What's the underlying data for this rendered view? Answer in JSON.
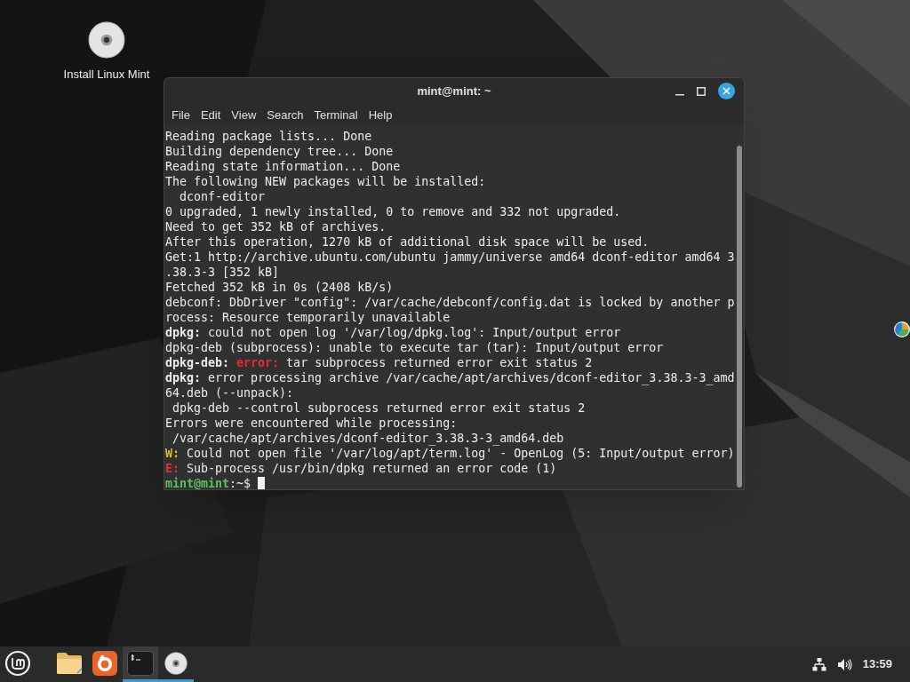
{
  "desktop_icons": [
    {
      "label": "Install Linux Mint"
    }
  ],
  "window": {
    "title": "mint@mint: ~",
    "menu": [
      "File",
      "Edit",
      "View",
      "Search",
      "Terminal",
      "Help"
    ]
  },
  "terminal": {
    "lines": [
      [
        {
          "kind": "plain",
          "text": "Reading package lists... Done"
        }
      ],
      [
        {
          "kind": "plain",
          "text": "Building dependency tree... Done"
        }
      ],
      [
        {
          "kind": "plain",
          "text": "Reading state information... Done"
        }
      ],
      [
        {
          "kind": "plain",
          "text": "The following NEW packages will be installed:"
        }
      ],
      [
        {
          "kind": "plain",
          "text": "  dconf-editor"
        }
      ],
      [
        {
          "kind": "plain",
          "text": "0 upgraded, 1 newly installed, 0 to remove and 332 not upgraded."
        }
      ],
      [
        {
          "kind": "plain",
          "text": "Need to get 352 kB of archives."
        }
      ],
      [
        {
          "kind": "plain",
          "text": "After this operation, 1270 kB of additional disk space will be used."
        }
      ],
      [
        {
          "kind": "plain",
          "text": "Get:1 http://archive.ubuntu.com/ubuntu jammy/universe amd64 dconf-editor amd64 3"
        }
      ],
      [
        {
          "kind": "plain",
          "text": ".38.3-3 [352 kB]"
        }
      ],
      [
        {
          "kind": "plain",
          "text": "Fetched 352 kB in 0s (2408 kB/s)"
        }
      ],
      [
        {
          "kind": "plain",
          "text": "debconf: DbDriver \"config\": /var/cache/debconf/config.dat is locked by another p"
        }
      ],
      [
        {
          "kind": "plain",
          "text": "rocess: Resource temporarily unavailable"
        }
      ],
      [
        {
          "kind": "bold",
          "text": "dpkg:"
        },
        {
          "kind": "plain",
          "text": " could not open log '/var/log/dpkg.log': Input/output error"
        }
      ],
      [
        {
          "kind": "plain",
          "text": "dpkg-deb (subprocess): unable to execute tar (tar): Input/output error"
        }
      ],
      [
        {
          "kind": "bold",
          "text": "dpkg-deb: "
        },
        {
          "kind": "error",
          "text": "error:"
        },
        {
          "kind": "plain",
          "text": " tar subprocess returned error exit status 2"
        }
      ],
      [
        {
          "kind": "bold",
          "text": "dpkg:"
        },
        {
          "kind": "plain",
          "text": " error processing archive /var/cache/apt/archives/dconf-editor_3.38.3-3_amd"
        }
      ],
      [
        {
          "kind": "plain",
          "text": "64.deb (--unpack):"
        }
      ],
      [
        {
          "kind": "plain",
          "text": " dpkg-deb --control subprocess returned error exit status 2"
        }
      ],
      [
        {
          "kind": "plain",
          "text": "Errors were encountered while processing:"
        }
      ],
      [
        {
          "kind": "plain",
          "text": " /var/cache/apt/archives/dconf-editor_3.38.3-3_amd64.deb"
        }
      ],
      [
        {
          "kind": "warning",
          "text": "W:"
        },
        {
          "kind": "plain",
          "text": " Could not open file '/var/log/apt/term.log' - OpenLog (5: Input/output error)"
        }
      ],
      [
        {
          "kind": "error",
          "text": "E:"
        },
        {
          "kind": "plain",
          "text": " Sub-process /usr/bin/dpkg returned an error code (1)"
        }
      ],
      [
        {
          "kind": "prompt",
          "text": "mint@mint"
        },
        {
          "kind": "plain",
          "text": ":~$ "
        }
      ]
    ]
  },
  "taskbar": {
    "items": [
      {
        "kind": "menu",
        "running": false,
        "focused": false
      },
      {
        "kind": "files",
        "running": false,
        "focused": false
      },
      {
        "kind": "firefox",
        "running": false,
        "focused": false
      },
      {
        "kind": "terminal",
        "running": true,
        "focused": true
      },
      {
        "kind": "disc",
        "running": true,
        "focused": false
      }
    ],
    "clock": "13:59"
  }
}
